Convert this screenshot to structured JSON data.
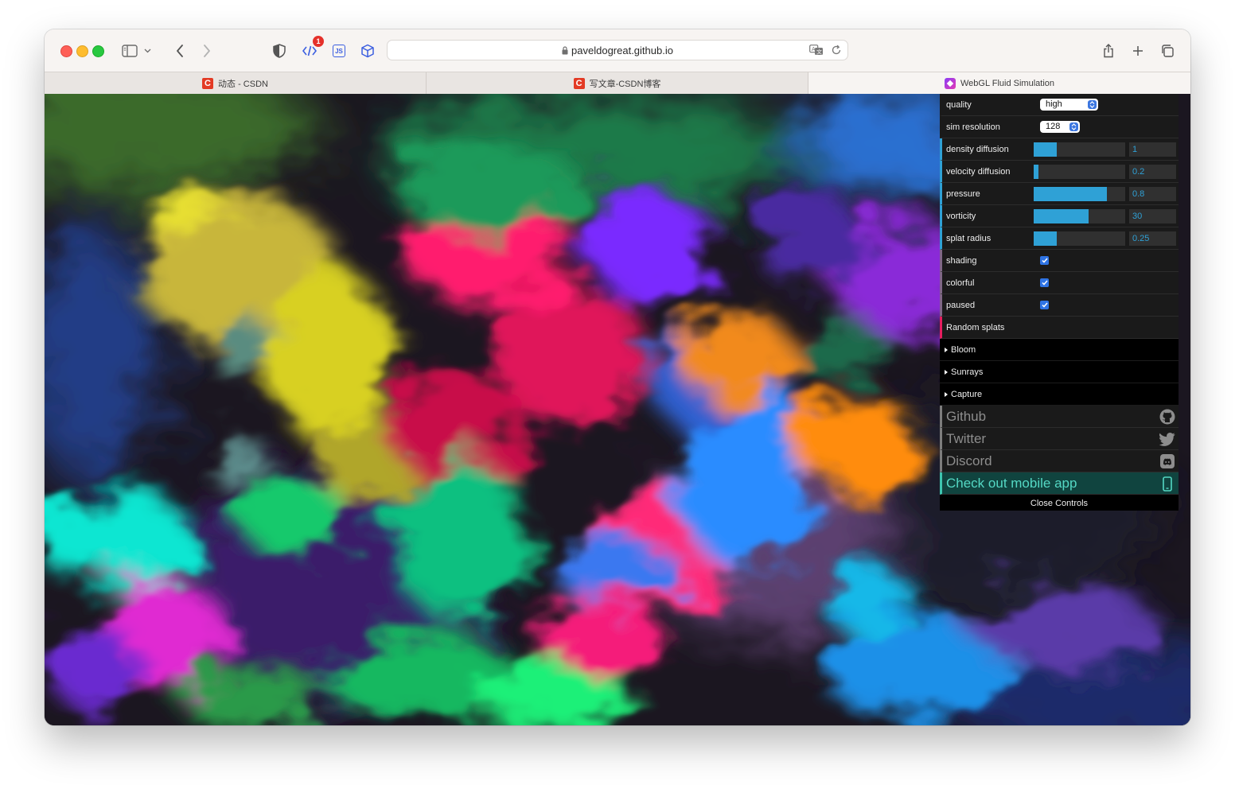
{
  "browser": {
    "url": "paveldogreat.github.io",
    "badge_count": "1",
    "js_label": "JS",
    "tabs": [
      {
        "title": "动态 - CSDN",
        "favicon": "csdn-icon",
        "favicon_char": "C"
      },
      {
        "title": "写文章-CSDN博客",
        "favicon": "csdn-icon",
        "favicon_char": "C"
      },
      {
        "title": "WebGL Fluid Simulation",
        "favicon": "webgl-icon",
        "active": true
      }
    ]
  },
  "controls": {
    "quality": {
      "label": "quality",
      "value": "high"
    },
    "sim_resolution": {
      "label": "sim resolution",
      "value": "128"
    },
    "density_diffusion": {
      "label": "density diffusion",
      "value": "1",
      "fill": 0.25
    },
    "velocity_diffusion": {
      "label": "velocity diffusion",
      "value": "0.2",
      "fill": 0.05
    },
    "pressure": {
      "label": "pressure",
      "value": "0.8",
      "fill": 0.8
    },
    "vorticity": {
      "label": "vorticity",
      "value": "30",
      "fill": 0.6
    },
    "splat_radius": {
      "label": "splat radius",
      "value": "0.25",
      "fill": 0.25
    },
    "shading": {
      "label": "shading",
      "checked": true
    },
    "colorful": {
      "label": "colorful",
      "checked": true
    },
    "paused": {
      "label": "paused",
      "checked": true
    },
    "random_splats": {
      "label": "Random splats"
    },
    "folders": {
      "bloom": "Bloom",
      "sunrays": "Sunrays",
      "capture": "Capture"
    },
    "links": {
      "github": "Github",
      "twitter": "Twitter",
      "discord": "Discord",
      "mobile_app": "Check out mobile app"
    },
    "close": "Close Controls"
  },
  "colors": {
    "number_accent": "#2fa1d6",
    "function_accent": "#e61d5f",
    "app_accent": "#3ec5b0"
  }
}
